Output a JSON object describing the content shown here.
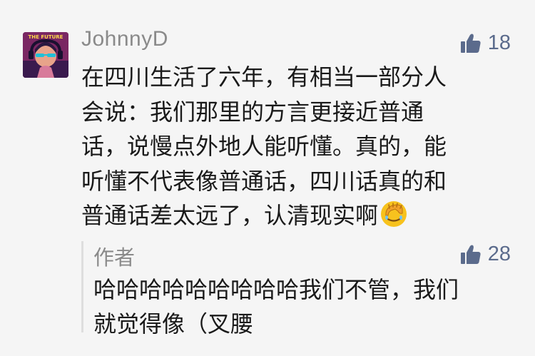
{
  "comment": {
    "username": "JohnnyD",
    "avatar_text": "THE FUTURE",
    "likes": "18",
    "text_lines": [
      "在四川生活了六年，有相当一部分人",
      "会说：我们那里的方言更接近普通",
      "话，说慢点外地人能听懂。真的，能",
      "听懂不代表像普通话，四川话真的和",
      "普通话差太远了，认清现实啊"
    ],
    "emoji": "facepalm-emoji"
  },
  "reply": {
    "author": "作者",
    "likes": "28",
    "text_lines": [
      "哈哈哈哈哈哈哈哈哈我们不管，我们",
      "就觉得像（叉腰"
    ]
  },
  "colors": {
    "background": "#f5f5f5",
    "username": "#8a8a8a",
    "like_icon": "#5b6b8c",
    "text": "#1a1a1a",
    "reply_border": "#dedede"
  },
  "icons": {
    "like": "thumb-up-icon",
    "avatar": "avatar-image"
  }
}
